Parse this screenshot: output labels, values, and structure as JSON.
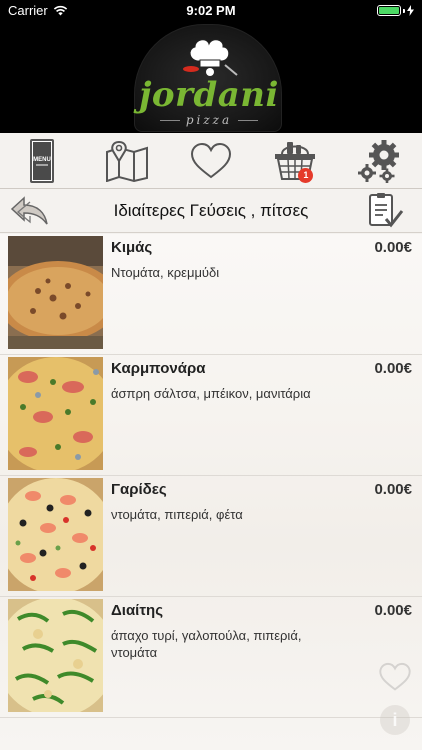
{
  "status_bar": {
    "carrier": "Carrier",
    "time": "9:02 PM"
  },
  "header": {
    "logo_text": "jordani",
    "logo_sub": "pizza"
  },
  "toolbar": {
    "menu_icon_label": "MENU",
    "cart_count": "1",
    "icons": [
      "menu-icon",
      "map-icon",
      "heart-icon",
      "cart-icon",
      "settings-icon"
    ]
  },
  "titlebar": {
    "title": "Ιδιαίτερες Γεύσεις , πίτσες"
  },
  "products": [
    {
      "name": "Κιμάς",
      "price": "0.00€",
      "description": "Ντομάτα, κρεμμύδι"
    },
    {
      "name": "Καρμπονάρα",
      "price": "0.00€",
      "description": "άσπρη σάλτσα, μπέικον, μανιτάρια"
    },
    {
      "name": "Γαρίδες",
      "price": "0.00€",
      "description": "ντομάτα, πιπεριά, φέτα"
    },
    {
      "name": "Διαίτης",
      "price": "0.00€",
      "description": "άπαχο τυρί, γαλοπούλα, πιπεριά, ντομάτα"
    }
  ],
  "floating": {
    "info_label": "i"
  },
  "colors": {
    "accent_red": "#e53a2a",
    "logo_green": "#7ab733",
    "logo_red": "#d52b1e",
    "icon_gray": "#555555"
  }
}
